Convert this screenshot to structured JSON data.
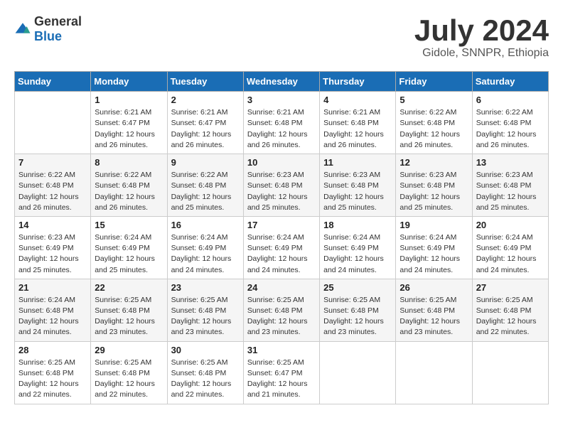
{
  "header": {
    "logo_general": "General",
    "logo_blue": "Blue",
    "month_title": "July 2024",
    "location": "Gidole, SNNPR, Ethiopia"
  },
  "weekdays": [
    "Sunday",
    "Monday",
    "Tuesday",
    "Wednesday",
    "Thursday",
    "Friday",
    "Saturday"
  ],
  "weeks": [
    [
      {
        "day": "",
        "sunrise": "",
        "sunset": "",
        "daylight": ""
      },
      {
        "day": "1",
        "sunrise": "Sunrise: 6:21 AM",
        "sunset": "Sunset: 6:47 PM",
        "daylight": "Daylight: 12 hours and 26 minutes."
      },
      {
        "day": "2",
        "sunrise": "Sunrise: 6:21 AM",
        "sunset": "Sunset: 6:47 PM",
        "daylight": "Daylight: 12 hours and 26 minutes."
      },
      {
        "day": "3",
        "sunrise": "Sunrise: 6:21 AM",
        "sunset": "Sunset: 6:48 PM",
        "daylight": "Daylight: 12 hours and 26 minutes."
      },
      {
        "day": "4",
        "sunrise": "Sunrise: 6:21 AM",
        "sunset": "Sunset: 6:48 PM",
        "daylight": "Daylight: 12 hours and 26 minutes."
      },
      {
        "day": "5",
        "sunrise": "Sunrise: 6:22 AM",
        "sunset": "Sunset: 6:48 PM",
        "daylight": "Daylight: 12 hours and 26 minutes."
      },
      {
        "day": "6",
        "sunrise": "Sunrise: 6:22 AM",
        "sunset": "Sunset: 6:48 PM",
        "daylight": "Daylight: 12 hours and 26 minutes."
      }
    ],
    [
      {
        "day": "7",
        "sunrise": "Sunrise: 6:22 AM",
        "sunset": "Sunset: 6:48 PM",
        "daylight": "Daylight: 12 hours and 26 minutes."
      },
      {
        "day": "8",
        "sunrise": "Sunrise: 6:22 AM",
        "sunset": "Sunset: 6:48 PM",
        "daylight": "Daylight: 12 hours and 26 minutes."
      },
      {
        "day": "9",
        "sunrise": "Sunrise: 6:22 AM",
        "sunset": "Sunset: 6:48 PM",
        "daylight": "Daylight: 12 hours and 25 minutes."
      },
      {
        "day": "10",
        "sunrise": "Sunrise: 6:23 AM",
        "sunset": "Sunset: 6:48 PM",
        "daylight": "Daylight: 12 hours and 25 minutes."
      },
      {
        "day": "11",
        "sunrise": "Sunrise: 6:23 AM",
        "sunset": "Sunset: 6:48 PM",
        "daylight": "Daylight: 12 hours and 25 minutes."
      },
      {
        "day": "12",
        "sunrise": "Sunrise: 6:23 AM",
        "sunset": "Sunset: 6:48 PM",
        "daylight": "Daylight: 12 hours and 25 minutes."
      },
      {
        "day": "13",
        "sunrise": "Sunrise: 6:23 AM",
        "sunset": "Sunset: 6:48 PM",
        "daylight": "Daylight: 12 hours and 25 minutes."
      }
    ],
    [
      {
        "day": "14",
        "sunrise": "Sunrise: 6:23 AM",
        "sunset": "Sunset: 6:49 PM",
        "daylight": "Daylight: 12 hours and 25 minutes."
      },
      {
        "day": "15",
        "sunrise": "Sunrise: 6:24 AM",
        "sunset": "Sunset: 6:49 PM",
        "daylight": "Daylight: 12 hours and 25 minutes."
      },
      {
        "day": "16",
        "sunrise": "Sunrise: 6:24 AM",
        "sunset": "Sunset: 6:49 PM",
        "daylight": "Daylight: 12 hours and 24 minutes."
      },
      {
        "day": "17",
        "sunrise": "Sunrise: 6:24 AM",
        "sunset": "Sunset: 6:49 PM",
        "daylight": "Daylight: 12 hours and 24 minutes."
      },
      {
        "day": "18",
        "sunrise": "Sunrise: 6:24 AM",
        "sunset": "Sunset: 6:49 PM",
        "daylight": "Daylight: 12 hours and 24 minutes."
      },
      {
        "day": "19",
        "sunrise": "Sunrise: 6:24 AM",
        "sunset": "Sunset: 6:49 PM",
        "daylight": "Daylight: 12 hours and 24 minutes."
      },
      {
        "day": "20",
        "sunrise": "Sunrise: 6:24 AM",
        "sunset": "Sunset: 6:49 PM",
        "daylight": "Daylight: 12 hours and 24 minutes."
      }
    ],
    [
      {
        "day": "21",
        "sunrise": "Sunrise: 6:24 AM",
        "sunset": "Sunset: 6:48 PM",
        "daylight": "Daylight: 12 hours and 24 minutes."
      },
      {
        "day": "22",
        "sunrise": "Sunrise: 6:25 AM",
        "sunset": "Sunset: 6:48 PM",
        "daylight": "Daylight: 12 hours and 23 minutes."
      },
      {
        "day": "23",
        "sunrise": "Sunrise: 6:25 AM",
        "sunset": "Sunset: 6:48 PM",
        "daylight": "Daylight: 12 hours and 23 minutes."
      },
      {
        "day": "24",
        "sunrise": "Sunrise: 6:25 AM",
        "sunset": "Sunset: 6:48 PM",
        "daylight": "Daylight: 12 hours and 23 minutes."
      },
      {
        "day": "25",
        "sunrise": "Sunrise: 6:25 AM",
        "sunset": "Sunset: 6:48 PM",
        "daylight": "Daylight: 12 hours and 23 minutes."
      },
      {
        "day": "26",
        "sunrise": "Sunrise: 6:25 AM",
        "sunset": "Sunset: 6:48 PM",
        "daylight": "Daylight: 12 hours and 23 minutes."
      },
      {
        "day": "27",
        "sunrise": "Sunrise: 6:25 AM",
        "sunset": "Sunset: 6:48 PM",
        "daylight": "Daylight: 12 hours and 22 minutes."
      }
    ],
    [
      {
        "day": "28",
        "sunrise": "Sunrise: 6:25 AM",
        "sunset": "Sunset: 6:48 PM",
        "daylight": "Daylight: 12 hours and 22 minutes."
      },
      {
        "day": "29",
        "sunrise": "Sunrise: 6:25 AM",
        "sunset": "Sunset: 6:48 PM",
        "daylight": "Daylight: 12 hours and 22 minutes."
      },
      {
        "day": "30",
        "sunrise": "Sunrise: 6:25 AM",
        "sunset": "Sunset: 6:48 PM",
        "daylight": "Daylight: 12 hours and 22 minutes."
      },
      {
        "day": "31",
        "sunrise": "Sunrise: 6:25 AM",
        "sunset": "Sunset: 6:47 PM",
        "daylight": "Daylight: 12 hours and 21 minutes."
      },
      {
        "day": "",
        "sunrise": "",
        "sunset": "",
        "daylight": ""
      },
      {
        "day": "",
        "sunrise": "",
        "sunset": "",
        "daylight": ""
      },
      {
        "day": "",
        "sunrise": "",
        "sunset": "",
        "daylight": ""
      }
    ]
  ]
}
